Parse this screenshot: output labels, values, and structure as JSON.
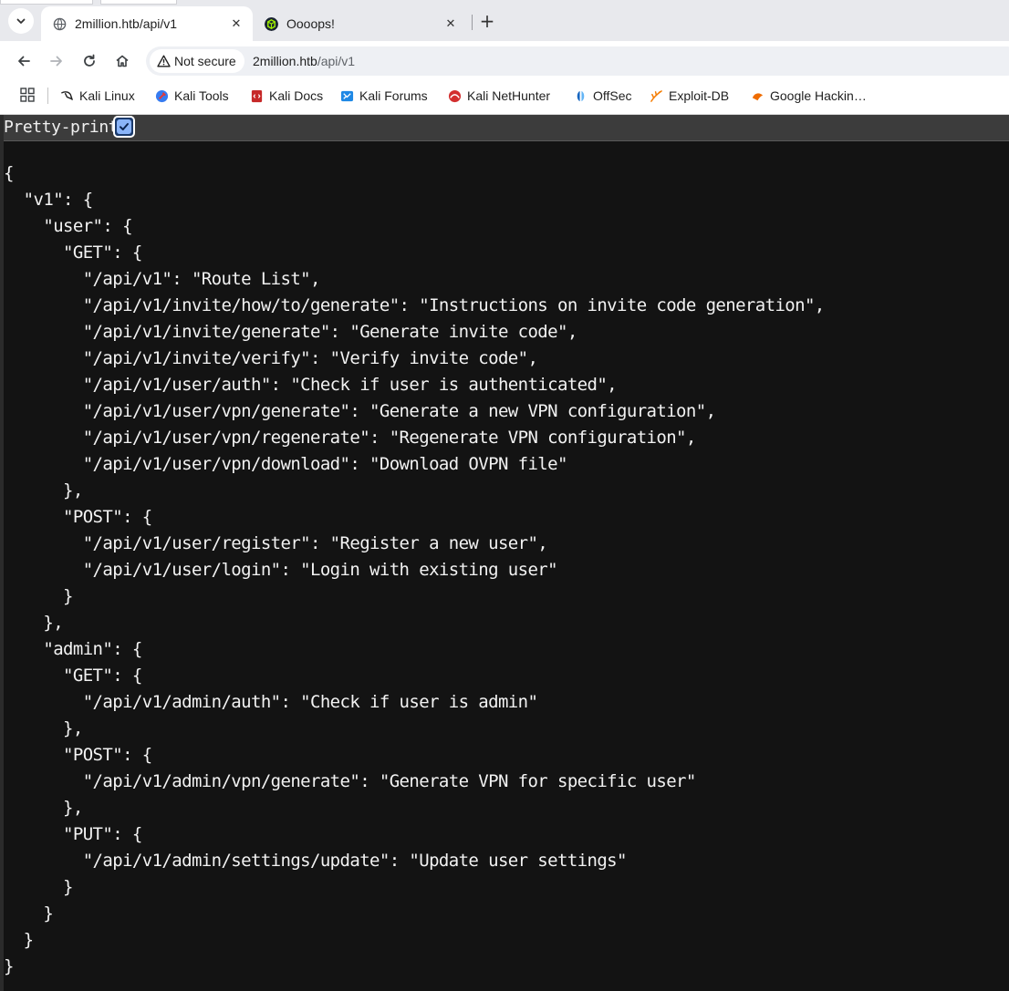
{
  "tabs": [
    {
      "title": "2million.htb/api/v1",
      "active": true
    },
    {
      "title": "Oooops!",
      "active": false
    }
  ],
  "toolbar": {
    "security_label": "Not secure",
    "url_host": "2million.htb",
    "url_path": "/api/v1"
  },
  "bookmarks": [
    {
      "label": "Kali Linux",
      "icon": "kali-dragon-icon"
    },
    {
      "label": "Kali Tools",
      "icon": "kali-tools-icon"
    },
    {
      "label": "Kali Docs",
      "icon": "kali-docs-icon"
    },
    {
      "label": "Kali Forums",
      "icon": "kali-forums-icon"
    },
    {
      "label": "Kali NetHunter",
      "icon": "kali-nethunter-icon"
    },
    {
      "label": "OffSec",
      "icon": "offsec-icon"
    },
    {
      "label": "Exploit-DB",
      "icon": "exploit-db-icon"
    },
    {
      "label": "Google Hackin…",
      "icon": "ghdb-icon"
    }
  ],
  "viewer": {
    "pretty_print_label": "Pretty-print",
    "pretty_print_checked": true
  },
  "json_lines": [
    "{",
    "  \"v1\": {",
    "    \"user\": {",
    "      \"GET\": {",
    "        \"/api/v1\": \"Route List\",",
    "        \"/api/v1/invite/how/to/generate\": \"Instructions on invite code generation\",",
    "        \"/api/v1/invite/generate\": \"Generate invite code\",",
    "        \"/api/v1/invite/verify\": \"Verify invite code\",",
    "        \"/api/v1/user/auth\": \"Check if user is authenticated\",",
    "        \"/api/v1/user/vpn/generate\": \"Generate a new VPN configuration\",",
    "        \"/api/v1/user/vpn/regenerate\": \"Regenerate VPN configuration\",",
    "        \"/api/v1/user/vpn/download\": \"Download OVPN file\"",
    "      },",
    "      \"POST\": {",
    "        \"/api/v1/user/register\": \"Register a new user\",",
    "        \"/api/v1/user/login\": \"Login with existing user\"",
    "      }",
    "    },",
    "    \"admin\": {",
    "      \"GET\": {",
    "        \"/api/v1/admin/auth\": \"Check if user is admin\"",
    "      },",
    "      \"POST\": {",
    "        \"/api/v1/admin/vpn/generate\": \"Generate VPN for specific user\"",
    "      },",
    "      \"PUT\": {",
    "        \"/api/v1/admin/settings/update\": \"Update user settings\"",
    "      }",
    "    }",
    "  }",
    "}"
  ]
}
